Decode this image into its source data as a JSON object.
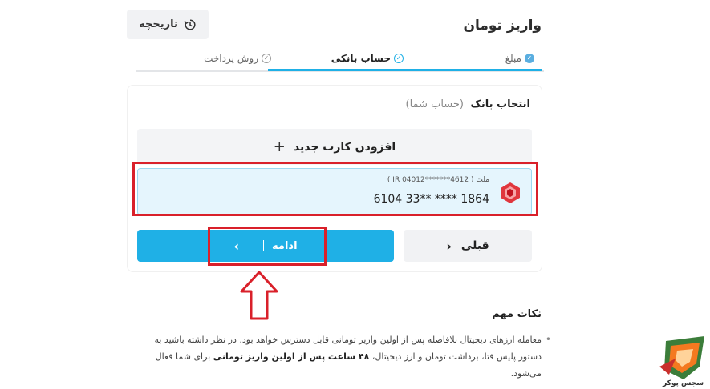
{
  "header": {
    "title": "واریز تومان",
    "history_label": "تاریخچه"
  },
  "steps": [
    {
      "label": "مبلغ",
      "state": "done"
    },
    {
      "label": "حساب بانکی",
      "state": "active"
    },
    {
      "label": "روش پرداخت",
      "state": "pending"
    }
  ],
  "bank_section": {
    "title": "انتخاب بانک",
    "subtitle": "(حساب شما)",
    "add_card_label": "افزودن کارت جدید",
    "selected_bank": {
      "bank_name": "ملت",
      "iban": "( IR 04012*******4612 )",
      "card_number": "6104 33** **** 1864"
    }
  },
  "actions": {
    "prev_label": "قبلی",
    "next_label": "ادامه"
  },
  "notes": {
    "title": "نکات مهم",
    "text_part1": "معامله ارزهای دیجیتال بلافاصله پس از اولین واریز تومانی قابل دسترس خواهد بود. در نظر داشته باشید به دستور پلیس فتا، برداشت تومان و ارز دیجیتال، ",
    "text_bold": "۴۸ ساعت پس از اولین واریز تومانی",
    "text_part2": " برای شما فعال می‌شود."
  },
  "watermark_text": "سجس پوکر",
  "colors": {
    "accent": "#1fb0e6",
    "highlight_red": "#d9202a",
    "bank_item_bg": "#e5f5fd"
  }
}
